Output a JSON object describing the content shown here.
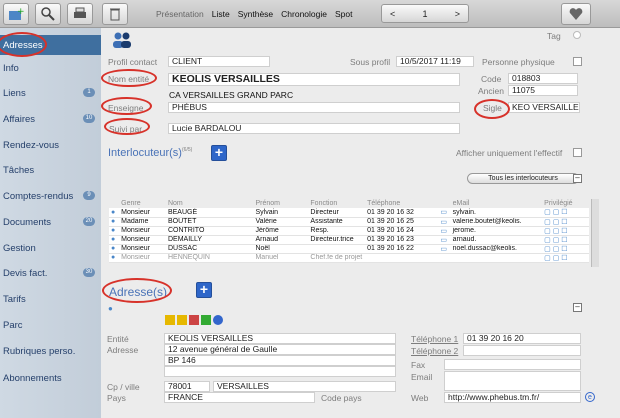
{
  "toolbar": {
    "tabs": [
      "Présentation",
      "Liste",
      "Synthèse",
      "Chronologie",
      "Spot"
    ],
    "page_number": "1"
  },
  "sidebar": {
    "items": [
      {
        "label": "Adresses",
        "badge": "",
        "active": true
      },
      {
        "label": "Info",
        "badge": ""
      },
      {
        "label": "Liens",
        "badge": "1"
      },
      {
        "label": "Affaires",
        "badge": "10"
      },
      {
        "label": "Rendez-vous",
        "badge": ""
      },
      {
        "label": "Tâches",
        "badge": ""
      },
      {
        "label": "Comptes-rendus",
        "badge": "9"
      },
      {
        "label": "Documents",
        "badge": "20"
      },
      {
        "label": "Gestion",
        "badge": ""
      },
      {
        "label": "Devis fact.",
        "badge": "30"
      },
      {
        "label": "Tarifs",
        "badge": ""
      },
      {
        "label": "Parc",
        "badge": ""
      },
      {
        "label": "Rubriques perso.",
        "badge": ""
      },
      {
        "label": "Abonnements",
        "badge": ""
      }
    ]
  },
  "header": {
    "tag_label": "Tag",
    "profil_label": "Profil contact",
    "profil_value": "CLIENT",
    "sous_profil_label": "Sous profil",
    "sous_profil_value": "10/5/2017 11:19",
    "personne_label": "Personne physique",
    "nom_label": "Nom entité",
    "nom_value": "KEOLIS VERSAILLES",
    "sub_value": "CA VERSAILLES GRAND PARC",
    "code_label": "Code",
    "code_value": "018803",
    "ancien_label": "Ancien",
    "ancien_value": "11075",
    "enseigne_label": "Enseigne",
    "enseigne_value": "PHÉBUS",
    "sigle_label": "Sigle",
    "sigle_value": "KEO VERSAILLES",
    "suivi_label": "Suivi par",
    "suivi_value": "Lucie BARDALOU"
  },
  "contacts": {
    "title": "Interlocuteur(s)",
    "count": "(6/5)",
    "filter_label": "Afficher uniquement l'effectif",
    "all_button": "Tous les interlocuteurs",
    "columns": [
      "Genre",
      "Nom",
      "Prénom",
      "Fonction",
      "Téléphone",
      "eMail",
      "Privilégié"
    ],
    "rows": [
      {
        "genre": "Monsieur",
        "nom": "BEAUGÉ",
        "prenom": "Sylvain",
        "fonction": "Directeur",
        "tel": "01 39 20 16 32",
        "email": "sylvain.",
        "inactive": false
      },
      {
        "genre": "Madame",
        "nom": "BOUTET",
        "prenom": "Valérie",
        "fonction": "Assistante",
        "tel": "01 39 20 16 25",
        "email": "valerie.boutet@keolis.",
        "inactive": false
      },
      {
        "genre": "Monsieur",
        "nom": "CONTRITO",
        "prenom": "Jérôme",
        "fonction": "Resp.",
        "tel": "01 39 20 16 24",
        "email": "jerome.",
        "inactive": false
      },
      {
        "genre": "Monsieur",
        "nom": "DEMAILLY",
        "prenom": "Arnaud",
        "fonction": "Directeur.trice",
        "tel": "01 39 20 16 23",
        "email": "arnaud.",
        "inactive": false
      },
      {
        "genre": "Monsieur",
        "nom": "DUSSAC",
        "prenom": "Noël",
        "fonction": "",
        "tel": "01 39 20 16 22",
        "email": "noel.dussac@keolis.",
        "inactive": false
      },
      {
        "genre": "Monsieur",
        "nom": "HENNEQUIN",
        "prenom": "Manuel",
        "fonction": "Chef.fe de projet",
        "tel": "",
        "email": "",
        "inactive": true
      }
    ]
  },
  "address": {
    "title": "Adresse(s)",
    "entite_label": "Entité",
    "entite_value": "KEOLIS VERSAILLES",
    "adresse_label": "Adresse",
    "line1": "12 avenue général de Gaulle",
    "line2": "BP 146",
    "cp_label": "Cp / ville",
    "cp_value": "78001",
    "ville_value": "VERSAILLES",
    "pays_label": "Pays",
    "pays_value": "FRANCE",
    "code_pays_label": "Code pays",
    "tel1_label": "Téléphone 1",
    "tel1_value": "01 39 20 16 20",
    "tel2_label": "Téléphone 2",
    "fax_label": "Fax",
    "email_label": "Email",
    "web_label": "Web",
    "web_value": "http://www.phebus.tm.fr/"
  },
  "colors": {
    "accent": "#2e66c9",
    "annotation": "#d7322a",
    "sidebar_active": "#3f6f9f"
  }
}
